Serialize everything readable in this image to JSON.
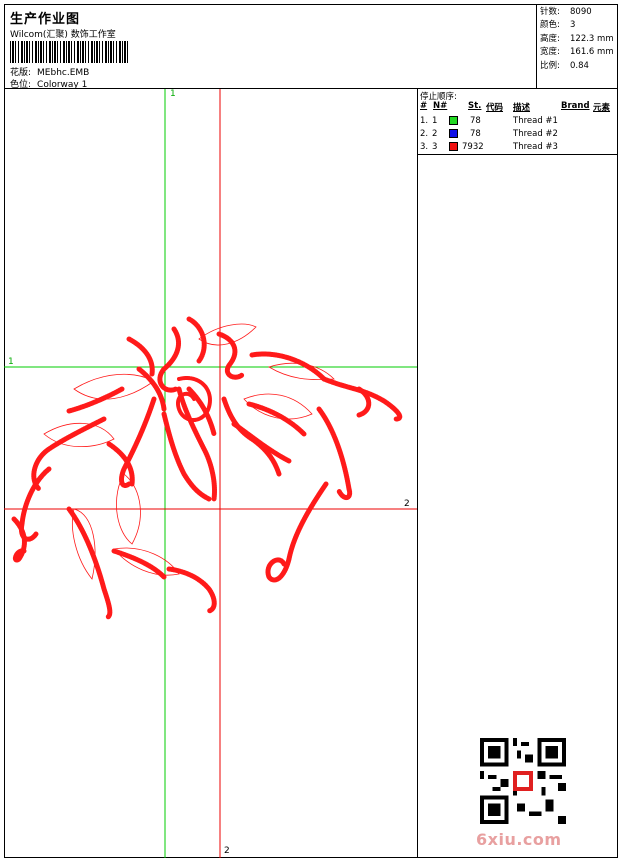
{
  "header": {
    "title": "生产作业图",
    "subtitle": "Wilcom(汇聚) 数饰工作室",
    "design_label": "花版:",
    "design_value": "MEbhc.EMB",
    "colorway_label": "色位:",
    "colorway_value": "Colorway 1"
  },
  "stats": [
    {
      "label": "针数:",
      "value": "8090"
    },
    {
      "label": "颜色:",
      "value": "3"
    },
    {
      "label": "高度:",
      "value": "122.3 mm"
    },
    {
      "label": "宽度:",
      "value": "161.6 mm"
    },
    {
      "label": "比例:",
      "value": "0.84"
    }
  ],
  "legend": {
    "title": "停止顺序:",
    "columns": [
      "#",
      "N#",
      "St.",
      "代码",
      "描述",
      "Brand",
      "元素"
    ],
    "rows": [
      {
        "num": "1.",
        "n": "1",
        "color": "#22d822",
        "code": "78",
        "desc": "Thread #1"
      },
      {
        "num": "2.",
        "n": "2",
        "color": "#1010e8",
        "code": "78",
        "desc": "Thread #2"
      },
      {
        "num": "3.",
        "n": "3",
        "color": "#f01010",
        "code": "7932",
        "desc": "Thread #3"
      }
    ]
  },
  "guides": {
    "green_vertical_label": "1",
    "green_horizontal_label": "1",
    "red_vertical_label": "2",
    "red_horizontal_label": "2"
  },
  "colors": {
    "embroidery": "#ff1a1a",
    "guide_green": "#00cc00",
    "guide_red": "#ee0000"
  },
  "watermark": "6xiu.com"
}
